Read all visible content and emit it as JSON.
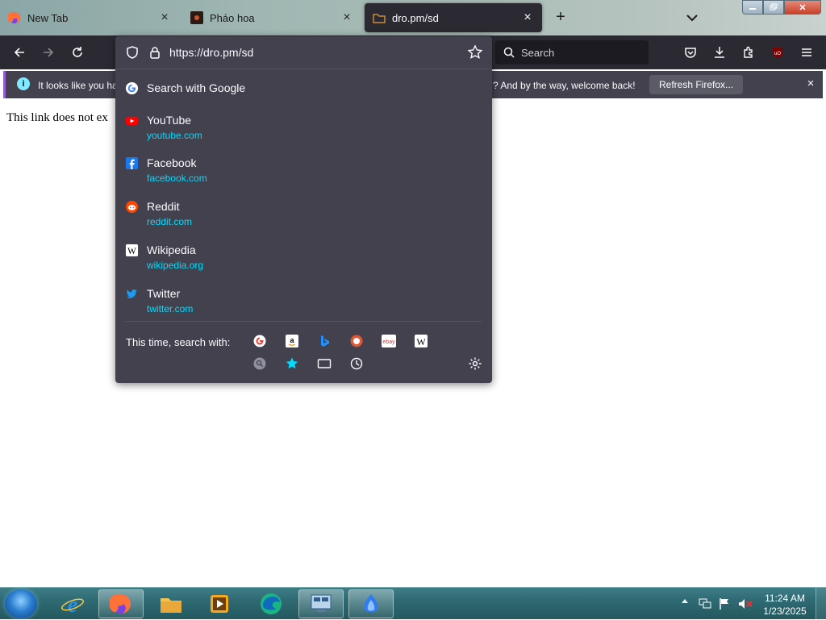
{
  "tabs": [
    {
      "label": "New Tab",
      "icon": "firefox-icon",
      "close": "×"
    },
    {
      "label": "Pháo hoa",
      "icon": "fireworks-favicon",
      "close": "×"
    },
    {
      "label": "dro.pm/sd",
      "icon": "dro-favicon",
      "close": "×",
      "active": true
    }
  ],
  "tabstrip": {
    "new_tab": "+"
  },
  "window_controls": {
    "close": "✕"
  },
  "searchbar": {
    "placeholder": "Search"
  },
  "notification": {
    "info": "i",
    "text_left": "It looks like you ha",
    "text_right": "? And by the way, welcome back!",
    "refresh_label": "Refresh Firefox...",
    "close": "×"
  },
  "page": {
    "text": "This link does not ex"
  },
  "urlbar": {
    "url": "https://dro.pm/sd",
    "search_with": "Search with Google",
    "results": [
      {
        "title": "YouTube",
        "url": "youtube.com"
      },
      {
        "title": "Facebook",
        "url": "facebook.com"
      },
      {
        "title": "Reddit",
        "url": "reddit.com"
      },
      {
        "title": "Wikipedia",
        "url": "wikipedia.org"
      },
      {
        "title": "Twitter",
        "url": "twitter.com"
      }
    ],
    "oneoff_label": "This time, search with:",
    "engines": [
      "google-icon",
      "amazon-icon",
      "bing-icon",
      "duckduckgo-icon",
      "ebay-icon",
      "wikipedia-icon"
    ],
    "modes": [
      "search-mode-icon",
      "bookmarks-icon",
      "tabs-icon",
      "history-icon"
    ]
  },
  "taskbar": {
    "clock_time": "11:24 AM",
    "clock_date": "1/23/2025",
    "apps": [
      "internet-explorer-icon",
      "firefox-icon",
      "file-explorer-icon",
      "media-player-icon",
      "edge-icon",
      "remote-desktop-icon",
      "app-icon"
    ]
  },
  "colors": {
    "accent": "#00ddff",
    "toolbar": "#2b2a33",
    "popup": "#42414d"
  }
}
